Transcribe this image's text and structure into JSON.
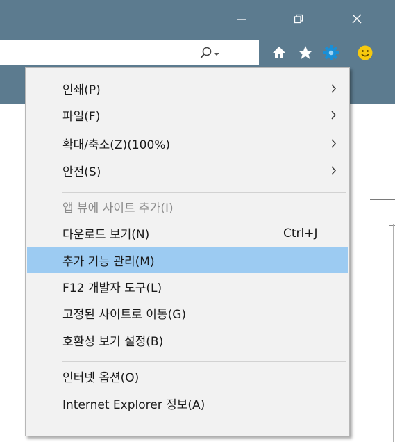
{
  "window_controls": {
    "minimize_icon": "minimize-icon",
    "restore_icon": "restore-icon",
    "close_icon": "close-icon"
  },
  "toolbar": {
    "icons": [
      "search-icon",
      "dropdown-icon",
      "home-icon",
      "star-icon",
      "gear-icon",
      "smiley-icon"
    ],
    "accent_colors": {
      "chrome": "#5c7b8f",
      "gear": "#1a8fd6",
      "smiley": "#f6c90e"
    }
  },
  "menu": {
    "highlight_color": "#9ccbf2",
    "items": [
      {
        "label": "인쇄(P)",
        "shortcut": "",
        "submenu": true,
        "disabled": false,
        "highlighted": false
      },
      {
        "label": "파일(F)",
        "shortcut": "",
        "submenu": true,
        "disabled": false,
        "highlighted": false
      },
      {
        "label": "확대/축소(Z)(100%)",
        "shortcut": "",
        "submenu": true,
        "disabled": false,
        "highlighted": false
      },
      {
        "label": "안전(S)",
        "shortcut": "",
        "submenu": true,
        "disabled": false,
        "highlighted": false
      },
      {
        "label": "앱 뷰에 사이트 추가(I)",
        "shortcut": "",
        "submenu": false,
        "disabled": true,
        "highlighted": false
      },
      {
        "label": "다운로드 보기(N)",
        "shortcut": "Ctrl+J",
        "submenu": false,
        "disabled": false,
        "highlighted": false
      },
      {
        "label": "추가 기능 관리(M)",
        "shortcut": "",
        "submenu": false,
        "disabled": false,
        "highlighted": true
      },
      {
        "label": "F12 개발자 도구(L)",
        "shortcut": "",
        "submenu": false,
        "disabled": false,
        "highlighted": false
      },
      {
        "label": "고정된 사이트로 이동(G)",
        "shortcut": "",
        "submenu": false,
        "disabled": false,
        "highlighted": false
      },
      {
        "label": "호환성 보기 설정(B)",
        "shortcut": "",
        "submenu": false,
        "disabled": false,
        "highlighted": false
      },
      {
        "label": "인터넷 옵션(O)",
        "shortcut": "",
        "submenu": false,
        "disabled": false,
        "highlighted": false
      },
      {
        "label": "Internet Explorer 정보(A)",
        "shortcut": "",
        "submenu": false,
        "disabled": false,
        "highlighted": false
      }
    ]
  }
}
